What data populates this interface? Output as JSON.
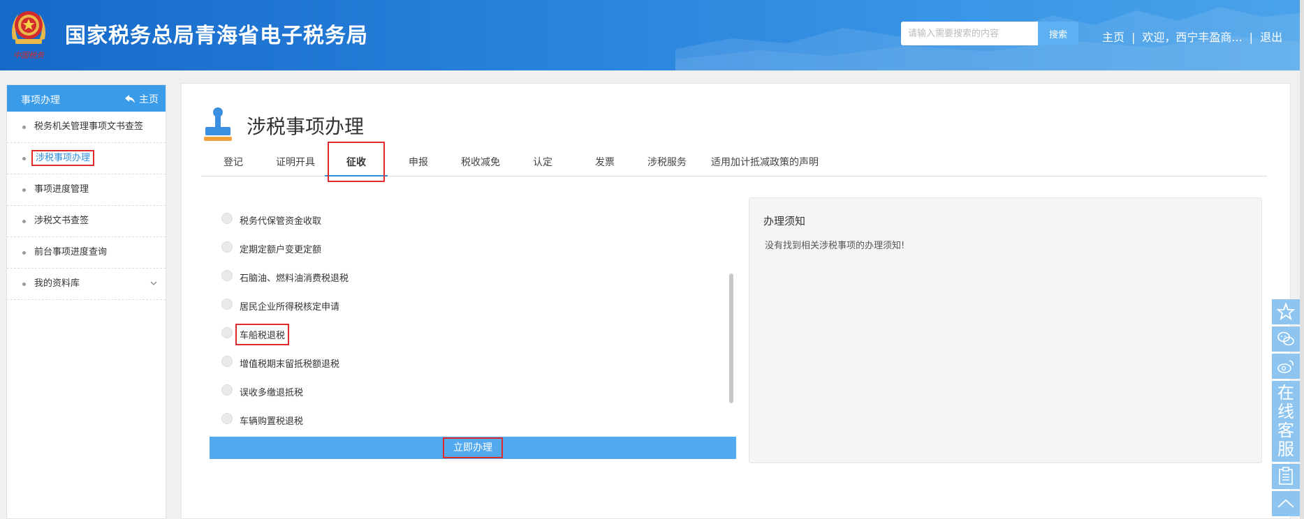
{
  "header": {
    "site_title": "国家税务总局青海省电子税务局",
    "emblem_caption": "中国税务",
    "search_placeholder": "请输入需要搜索的内容",
    "search_button": "搜索",
    "links": {
      "home": "主页",
      "welcome": "欢迎，西宁丰盈商...",
      "logout": "退出",
      "separator": "|"
    }
  },
  "sidebar": {
    "title": "事项办理",
    "home_label": "主页",
    "items": [
      {
        "label": "税务机关管理事项文书查签"
      },
      {
        "label": "涉税事项办理",
        "active": true
      },
      {
        "label": "事项进度管理"
      },
      {
        "label": "涉税文书查签"
      },
      {
        "label": "前台事项进度查询"
      },
      {
        "label": "我的资料库",
        "expandable": true
      }
    ]
  },
  "main": {
    "title": "涉税事项办理",
    "tabs": [
      {
        "label": "登记"
      },
      {
        "label": "证明开具"
      },
      {
        "label": "征收",
        "active": true
      },
      {
        "label": "申报"
      },
      {
        "label": "税收减免"
      },
      {
        "label": "认定"
      },
      {
        "label": "发票"
      },
      {
        "label": "涉税服务"
      },
      {
        "label": "适用加计抵减政策的声明"
      }
    ],
    "options": [
      {
        "label": "税务代保管资金收取"
      },
      {
        "label": "定期定额户变更定额"
      },
      {
        "label": "石脑油、燃料油消费税退税"
      },
      {
        "label": "居民企业所得税核定申请"
      },
      {
        "label": "车船税退税",
        "highlighted": true
      },
      {
        "label": "增值税期末留抵税额退税"
      },
      {
        "label": "误收多缴退抵税"
      },
      {
        "label": "车辆购置税退税"
      }
    ],
    "submit_button": "立即办理",
    "notice": {
      "title": "办理须知",
      "text": "没有找到相关涉税事项的办理须知!"
    }
  },
  "float_toolbar": {
    "online_service": "在线客服",
    "icons": [
      "star-icon",
      "wechat-icon",
      "weibo-icon",
      "note-icon",
      "chevron-up-icon"
    ]
  },
  "colors": {
    "header_blue": "#2a84dd",
    "accent": "#3a9be8",
    "button": "#53a9ee",
    "highlight_red": "#e02b2b"
  }
}
